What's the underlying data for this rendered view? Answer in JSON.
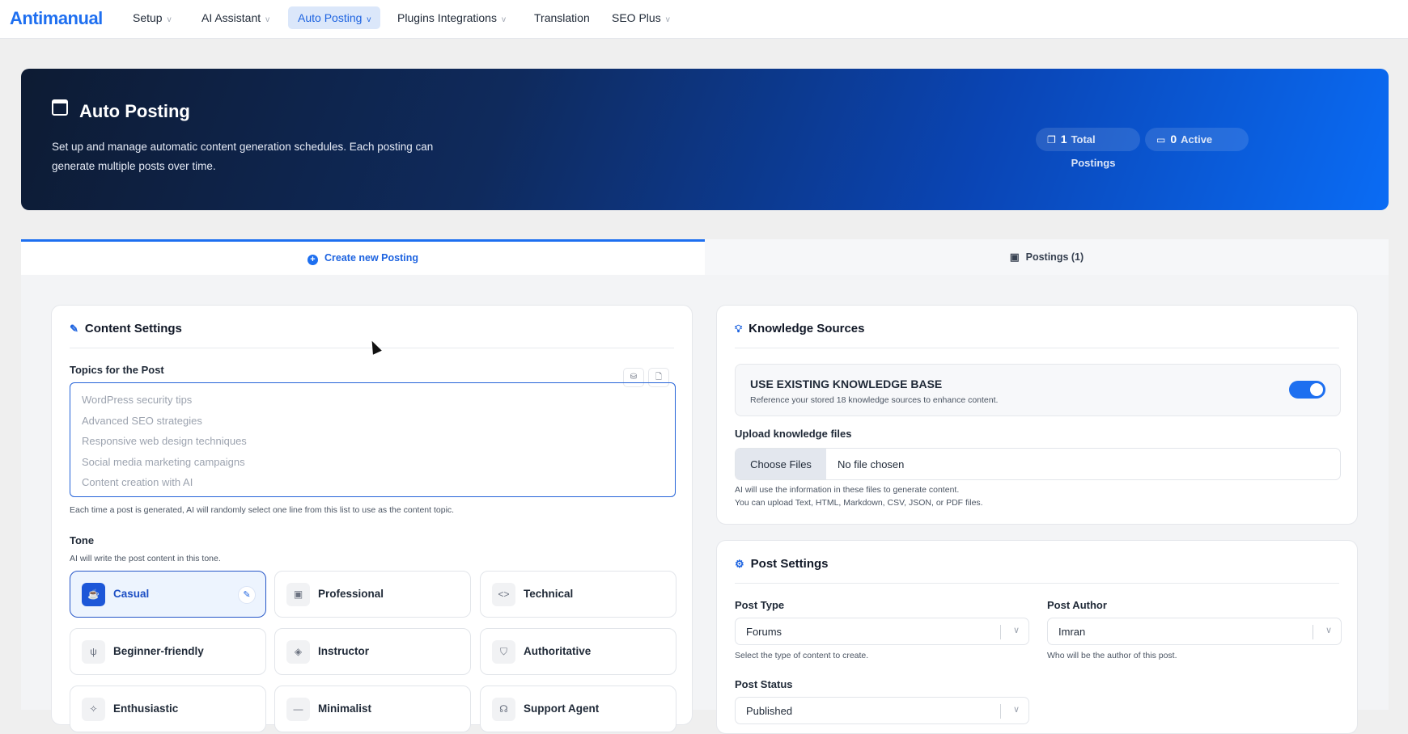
{
  "nav": {
    "logo": "Antimanual",
    "items": [
      {
        "label": "Setup",
        "chevron": "v"
      },
      {
        "label": "AI Assistant",
        "chevron": "v"
      },
      {
        "label": "Auto Posting",
        "chevron": "v"
      },
      {
        "label": "Plugins Integrations",
        "chevron": "v"
      },
      {
        "label": "Translation"
      },
      {
        "label": "SEO Plus",
        "chevron": "v"
      }
    ]
  },
  "hero": {
    "title": "Auto Posting",
    "description": "Set up and manage automatic content generation schedules. Each posting can generate multiple posts over time.",
    "stats": [
      {
        "value": "1",
        "label": "Total Postings",
        "icon": "copy-icon"
      },
      {
        "value": "0",
        "label": "Active",
        "icon": "calendar-icon"
      }
    ]
  },
  "tabs": [
    {
      "label": "Create new Posting",
      "icon": "+"
    },
    {
      "label": "Postings (1)",
      "icon": "▣"
    }
  ],
  "content_settings": {
    "title": "Content Settings",
    "topics_label": "Topics for the Post",
    "topics_placeholder": [
      "WordPress security tips",
      "Advanced SEO strategies",
      "Responsive web design techniques",
      "Social media marketing campaigns",
      "Content creation with AI"
    ],
    "topics_help": "Each time a post is generated, AI will randomly select one line from this list to use as the content topic.",
    "tone_label": "Tone",
    "tone_help": "AI will write the post content in this tone.",
    "tones": [
      {
        "label": "Casual",
        "icon": "☕",
        "selected": true
      },
      {
        "label": "Professional",
        "icon": "▣"
      },
      {
        "label": "Technical",
        "icon": "<>"
      },
      {
        "label": "Beginner-friendly",
        "icon": "ψ"
      },
      {
        "label": "Instructor",
        "icon": "◈"
      },
      {
        "label": "Authoritative",
        "icon": "⛉"
      },
      {
        "label": "Enthusiastic",
        "icon": "✧"
      },
      {
        "label": "Minimalist",
        "icon": "—"
      },
      {
        "label": "Support Agent",
        "icon": "☊"
      }
    ]
  },
  "knowledge": {
    "title": "Knowledge Sources",
    "kb_title": "USE EXISTING KNOWLEDGE BASE",
    "kb_desc": "Reference your stored 18 knowledge sources to enhance content.",
    "kb_enabled": true,
    "upload_label": "Upload knowledge files",
    "choose_files": "Choose Files",
    "no_file": "No file chosen",
    "help1": "AI will use the information in these files to generate content.",
    "help2": "You can upload Text, HTML, Markdown, CSV, JSON, or PDF files."
  },
  "post_settings": {
    "title": "Post Settings",
    "post_type_label": "Post Type",
    "post_type": "Forums",
    "post_type_help": "Select the type of content to create.",
    "post_author_label": "Post Author",
    "post_author": "Imran",
    "post_author_help": "Who will be the author of this post.",
    "post_status_label": "Post Status",
    "post_status": "Published"
  }
}
